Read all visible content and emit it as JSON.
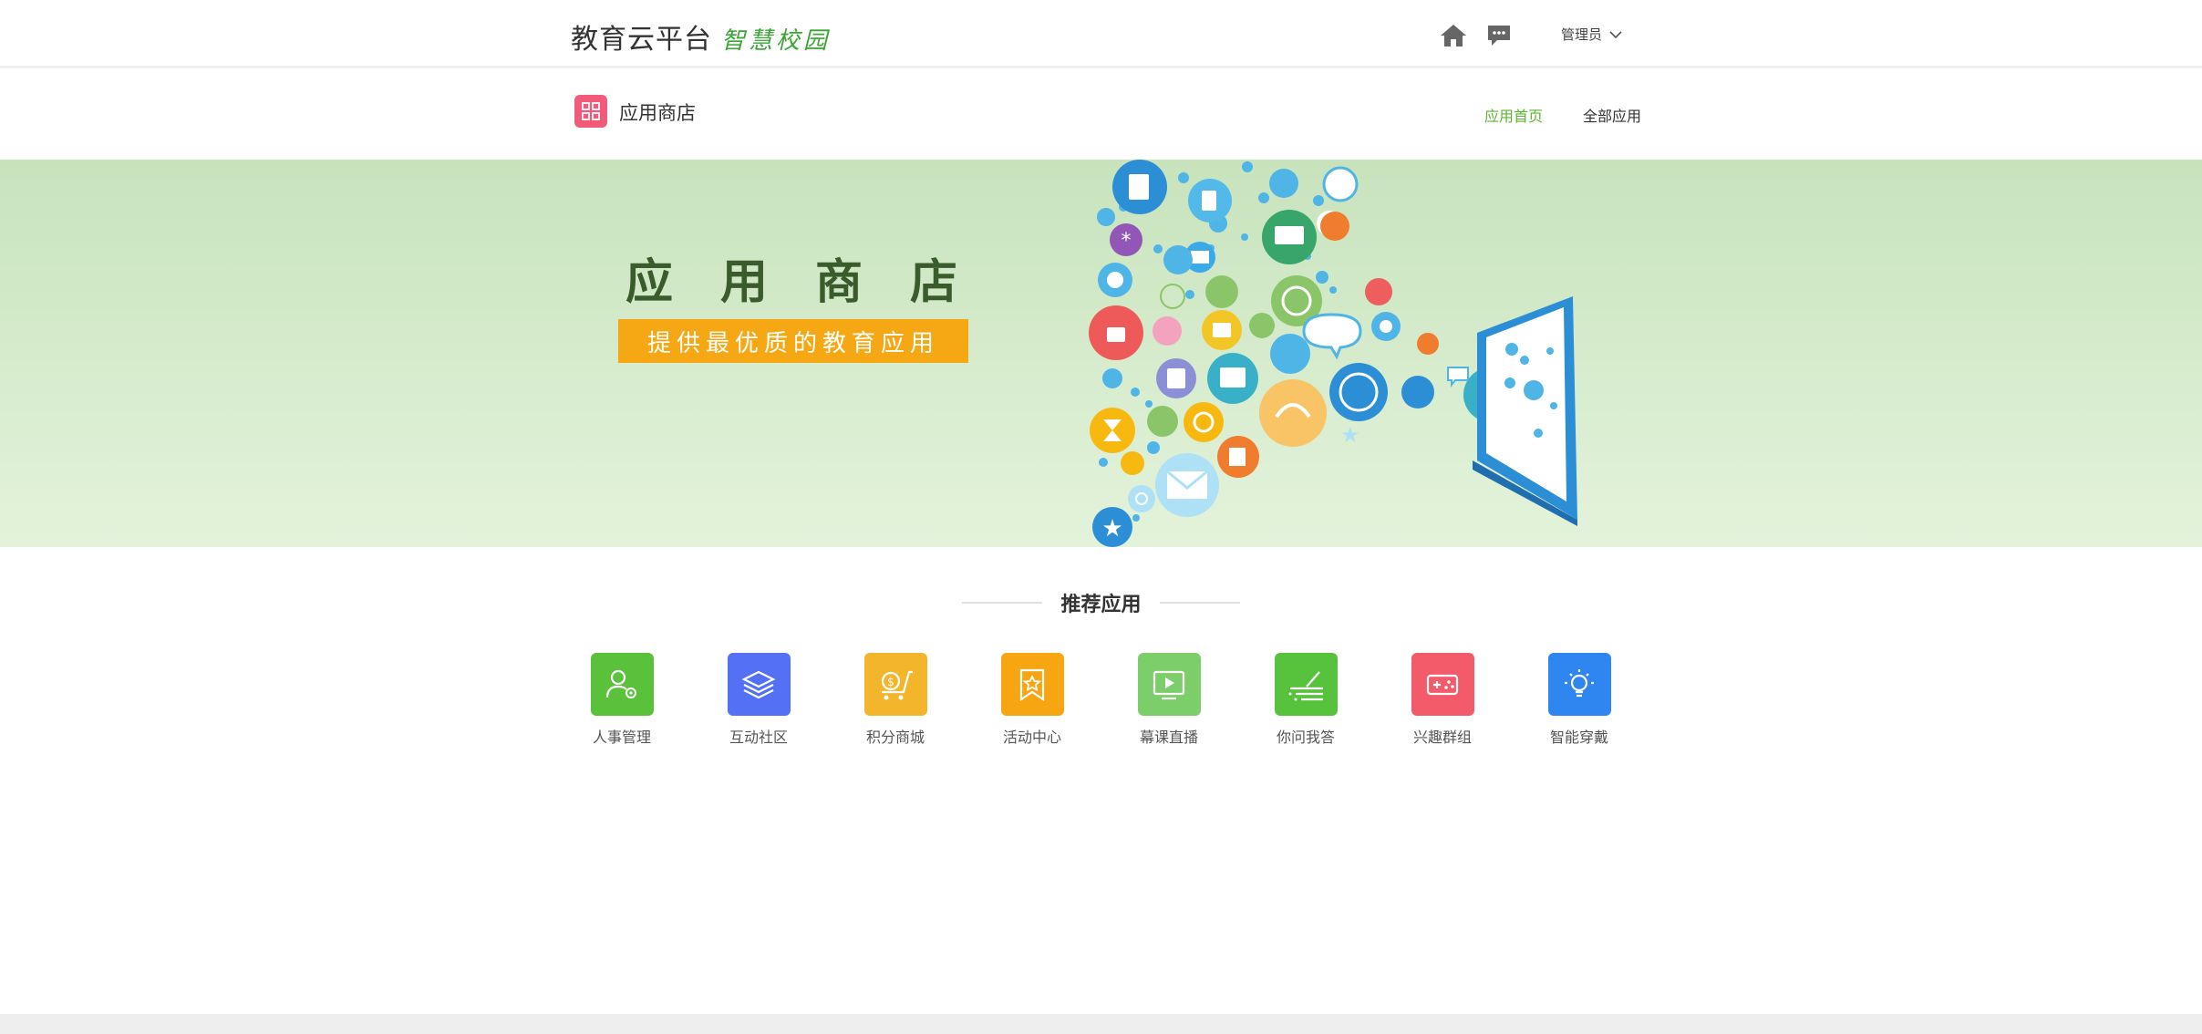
{
  "header": {
    "brand_main": "教育云平台",
    "brand_sub": "智慧校园",
    "home_icon": "home-icon",
    "message_icon": "message-icon",
    "user_label": "管理员"
  },
  "subnav": {
    "store_title": "应用商店",
    "links": [
      {
        "label": "应用首页",
        "active": true
      },
      {
        "label": "全部应用",
        "active": false
      }
    ]
  },
  "banner": {
    "title": "应用商店",
    "subtitle": "提供最优质的教育应用"
  },
  "recommended": {
    "title": "推荐应用",
    "apps": [
      {
        "label": "人事管理",
        "icon": "user-gear-icon",
        "color": "#5ac23a"
      },
      {
        "label": "互动社区",
        "icon": "layers-icon",
        "color": "#5470f5"
      },
      {
        "label": "积分商城",
        "icon": "cart-coin-icon",
        "color": "#f3b52c"
      },
      {
        "label": "活动中心",
        "icon": "star-bookmark-icon",
        "color": "#f7a510"
      },
      {
        "label": "幕课直播",
        "icon": "play-screen-icon",
        "color": "#7cce6a"
      },
      {
        "label": "你问我答",
        "icon": "pen-list-icon",
        "color": "#57c33d"
      },
      {
        "label": "兴趣群组",
        "icon": "gamepad-icon",
        "color": "#f35a6a"
      },
      {
        "label": "智能穿戴",
        "icon": "bulb-icon",
        "color": "#2f86f0"
      }
    ]
  }
}
